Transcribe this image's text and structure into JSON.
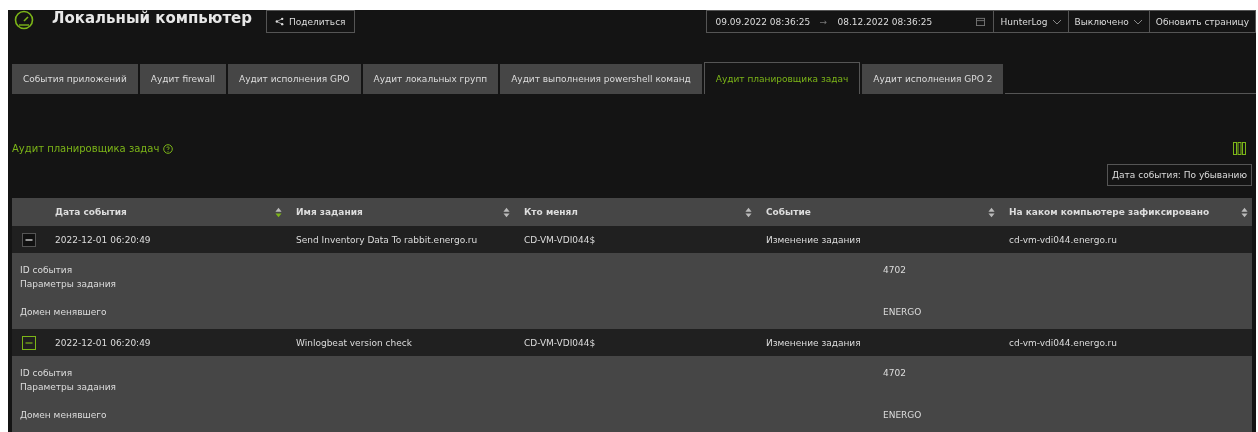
{
  "header": {
    "title": "Локальный компьютер",
    "share_button": "Поделиться",
    "date_from": "09.09.2022 08:36:25",
    "date_arrow": "→",
    "date_to": "08.12.2022 08:36:25",
    "source_select": "HunterLog",
    "mode_select": "Выключено",
    "refresh_button": "Обновить страницу"
  },
  "tabs": [
    {
      "label": "События приложений",
      "selected": false
    },
    {
      "label": "Аудит firewall",
      "selected": false
    },
    {
      "label": "Аудит исполнения GPO",
      "selected": false
    },
    {
      "label": "Аудит локальных групп",
      "selected": false
    },
    {
      "label": "Аудит выполнения powershell команд",
      "selected": false
    },
    {
      "label": "Аудит планировщика задач",
      "selected": true
    },
    {
      "label": "Аудит исполнения GPO 2",
      "selected": false
    }
  ],
  "section": {
    "title": "Аудит планировщика задач",
    "sort_label": "Дата события: По убыванию"
  },
  "table": {
    "columns": [
      {
        "label": "Дата события",
        "sorted_descending": true
      },
      {
        "label": "Имя задания",
        "sorted_descending": false
      },
      {
        "label": "Кто менял",
        "sorted_descending": false
      },
      {
        "label": "Событие",
        "sorted_descending": false
      },
      {
        "label": "На каком компьютере зафиксировано",
        "sorted_descending": false
      }
    ],
    "rows": [
      {
        "expanded": true,
        "hovered": false,
        "cells": [
          "2022-12-01 06:20:49",
          "Send Inventory Data To rabbit.energo.ru",
          "CD-VM-VDI044$",
          "Изменение задания",
          "cd-vm-vdi044.energo.ru"
        ],
        "details": [
          {
            "label": "ID события",
            "value": "4702"
          },
          {
            "label": "Параметры задания"
          },
          {
            "label": "Домен менявшего",
            "value": "ENERGO"
          }
        ]
      },
      {
        "expanded": true,
        "hovered": true,
        "cells": [
          "2022-12-01 06:20:49",
          "Winlogbeat version check",
          "CD-VM-VDI044$",
          "Изменение задания",
          "cd-vm-vdi044.energo.ru"
        ],
        "details": [
          {
            "label": "ID события",
            "value": "4702"
          },
          {
            "label": "Параметры задания"
          },
          {
            "label": "Домен менявшего",
            "value": "ENERGO"
          }
        ]
      }
    ]
  }
}
